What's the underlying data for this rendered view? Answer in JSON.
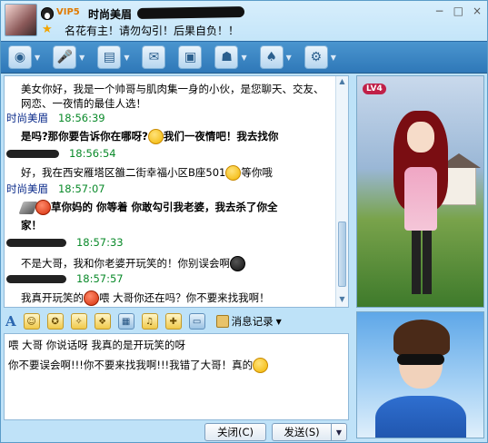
{
  "header": {
    "vip_badge": "VIP5",
    "nickname": "时尚美眉",
    "signature": "名花有主！请勿勾引！后果自负！！"
  },
  "window_controls": [
    "−",
    "□",
    "×"
  ],
  "toolbar": {
    "icons": [
      "webcam-icon",
      "microphone-icon",
      "folder-icon",
      "email-icon",
      "message-icon",
      "app-icon",
      "game-icon",
      "settings-icon"
    ]
  },
  "chat": {
    "messages": [
      {
        "text": "美女你好，我是一个帅哥与肌肉集一身的小伙，是您聊天、交友、"
      },
      {
        "text": "网恋、一夜情的最佳人选！"
      },
      {
        "sender": "时尚美眉",
        "time": "18:56:39"
      },
      {
        "text_before": "是吗?那你要告诉你在哪呀?",
        "text_after": "我们一夜情吧！我去找你"
      },
      {
        "time": "18:56:54"
      },
      {
        "text_before": "好，我在西安雁塔区雒二街幸福小区B座501",
        "text_after": "等你哦"
      },
      {
        "sender": "时尚美眉",
        "time": "18:57:07"
      },
      {
        "text_after": "草你妈的 你等着 你敢勾引我老婆，我去杀了你全"
      },
      {
        "text": "家！"
      },
      {
        "time": "18:57:33"
      },
      {
        "text": "不是大哥，我和你老婆开玩笑的！你别误会啊"
      },
      {
        "time": "18:57:57"
      },
      {
        "text_before": "我真开玩笑的",
        "text_after": "喂  大哥你还在吗？你不要来找我啊！"
      }
    ]
  },
  "right_panel": {
    "badge": "LV4"
  },
  "input_toolbar": {
    "font_label": "A",
    "history_label": "消息记录"
  },
  "input": {
    "line1": "喂  大哥  你说话呀  我真的是开玩笑的呀",
    "line2": "你不要误会啊!!!你不要来找我啊!!!我错了大哥！真的"
  },
  "buttons": {
    "close": "关闭(C)",
    "send": "发送(S)"
  }
}
